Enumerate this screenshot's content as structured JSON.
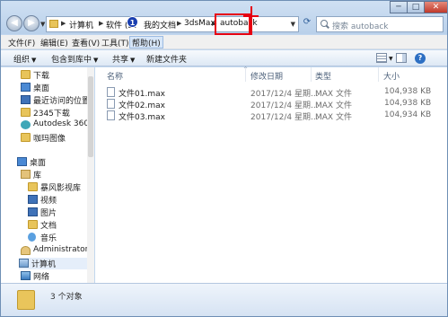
{
  "window": {
    "controls": {
      "minimize": "─",
      "maximize": "□",
      "close": "✕"
    }
  },
  "address": {
    "breadcrumbs": [
      "计算机",
      "软件 (D:",
      "我的文档",
      "3dsMax",
      "autoback"
    ],
    "search_placeholder": "搜索 autoback",
    "callout_number": "1"
  },
  "menu": [
    "文件(F)",
    "编辑(E)",
    "查看(V)",
    "工具(T)",
    "帮助(H)"
  ],
  "toolbar": {
    "organize": "组织",
    "include_library": "包含到库中",
    "share": "共享",
    "new_folder": "新建文件夹"
  },
  "nav": {
    "favorites": [
      "下载",
      "桌面",
      "最近访问的位置",
      "2345下载",
      "Autodesk 360",
      "咖玛图像"
    ],
    "desktop": "桌面",
    "library": "库",
    "libraries": [
      "暴风影视库",
      "视频",
      "图片",
      "文档",
      "音乐"
    ],
    "user": "Administrator",
    "computer": "计算机",
    "network": "网络"
  },
  "columns": {
    "name": "名称",
    "date": "修改日期",
    "type": "类型",
    "size": "大小"
  },
  "files": [
    {
      "name": "文件01.max",
      "date": "2017/12/4 星期...",
      "type": "MAX 文件",
      "size": "104,938 KB"
    },
    {
      "name": "文件02.max",
      "date": "2017/12/4 星期...",
      "type": "MAX 文件",
      "size": "104,938 KB"
    },
    {
      "name": "文件03.max",
      "date": "2017/12/4 星期...",
      "type": "MAX 文件",
      "size": "104,934 KB"
    }
  ],
  "status": {
    "count": "3 个对象"
  }
}
